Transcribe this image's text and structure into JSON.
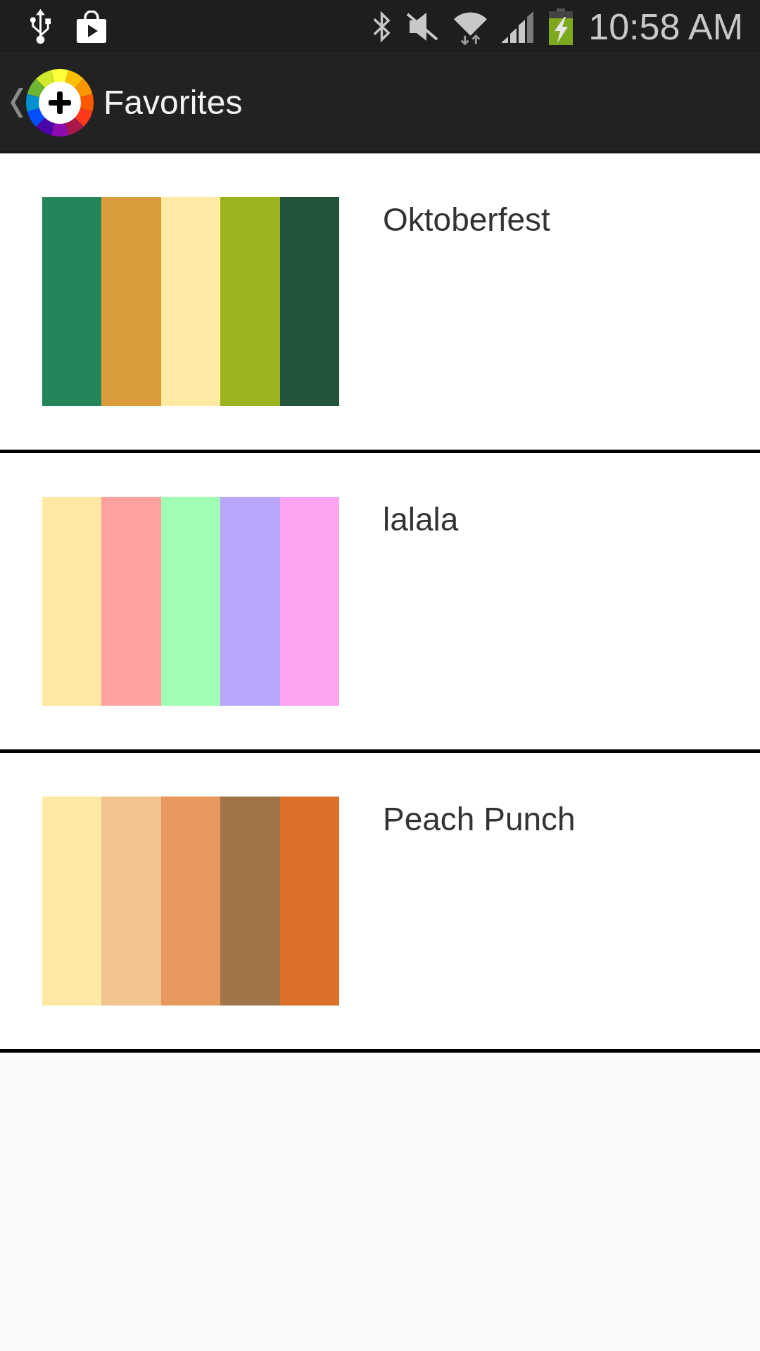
{
  "status_bar": {
    "time": "10:58 AM"
  },
  "action_bar": {
    "title": "Favorites"
  },
  "palettes": [
    {
      "name": "Oktoberfest",
      "stripes": [
        {
          "color": "#238559"
        },
        {
          "color": "#db9d3b"
        },
        {
          "color": "#ffeba3"
        },
        {
          "color": "#9bb41d"
        },
        {
          "color": "#20553b"
        }
      ]
    },
    {
      "name": "lalala",
      "stripes": [
        {
          "color": "#fde9a4"
        },
        {
          "color": "#fda1a1"
        },
        {
          "color": "#a3feb5"
        },
        {
          "color": "#bba6ff"
        },
        {
          "color": "#fea5f1"
        }
      ]
    },
    {
      "name": "Peach Punch",
      "stripes": [
        {
          "color": "#fde8a4"
        },
        {
          "color": "#f1c38f"
        },
        {
          "color": "#e6985f"
        },
        {
          "color": "#a2744a"
        },
        {
          "color": "#db702a"
        }
      ]
    }
  ]
}
